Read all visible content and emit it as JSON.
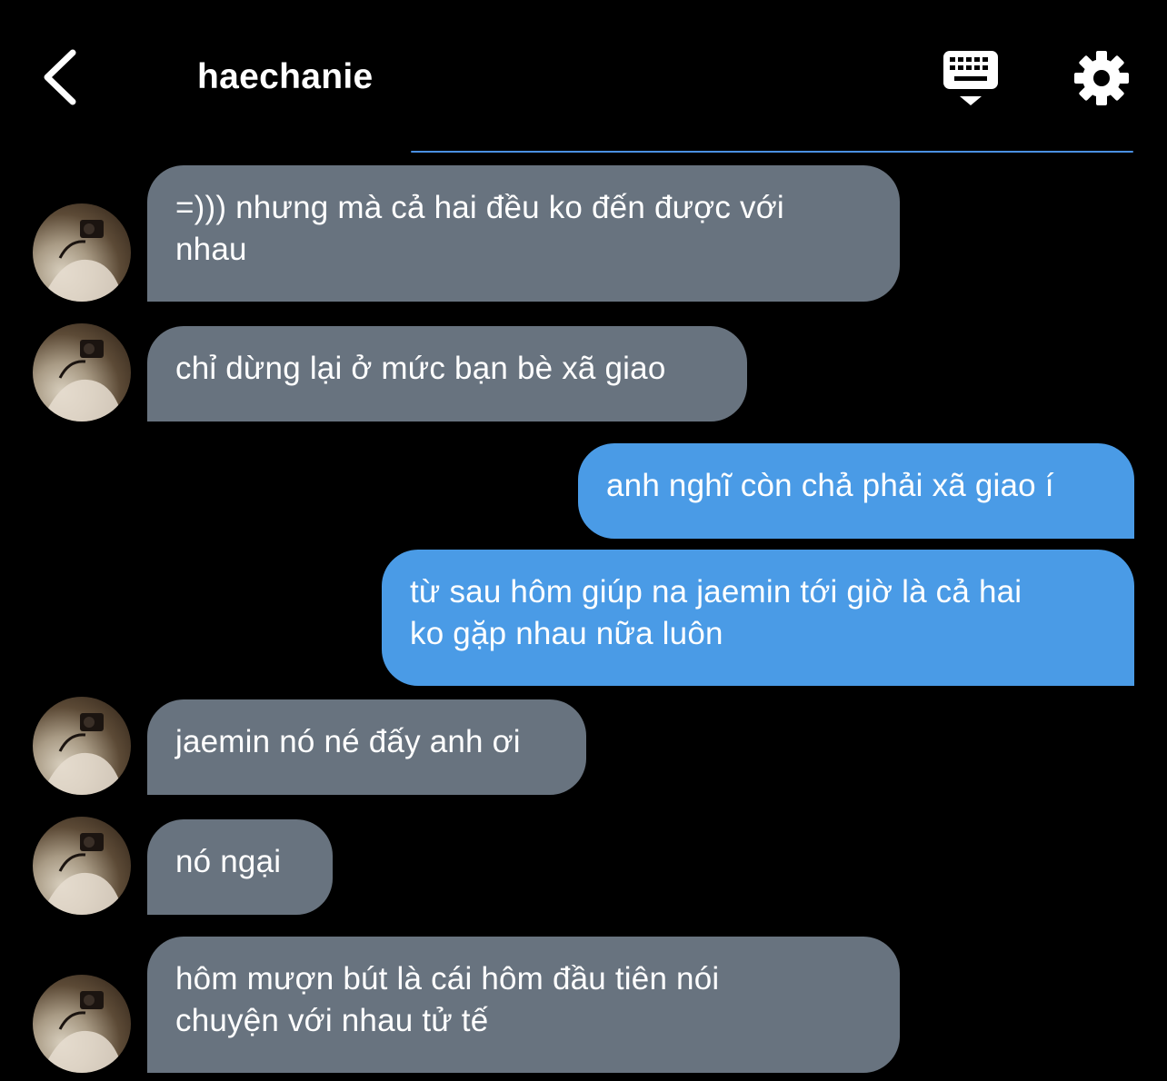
{
  "header": {
    "title": "haechanie",
    "back_icon": "chevron-left-icon",
    "keyboard_icon": "keyboard-icon",
    "settings_icon": "gear-icon"
  },
  "colors": {
    "background": "#000000",
    "incoming_bubble": "#68737f",
    "outgoing_bubble": "#4a9be6",
    "accent_line": "#4a90e2",
    "text": "#ffffff"
  },
  "messages": [
    {
      "direction": "in",
      "lines": [
        "=))) nhưng mà cả hai đều ko đến được với",
        "nhau"
      ]
    },
    {
      "direction": "in",
      "lines": [
        "chỉ dừng lại ở mức bạn bè xã giao"
      ]
    },
    {
      "direction": "out",
      "lines": [
        "anh nghĩ còn chả phải xã giao í"
      ]
    },
    {
      "direction": "out",
      "lines": [
        "từ sau hôm giúp na jaemin tới giờ là cả hai",
        "ko gặp nhau nữa luôn"
      ]
    },
    {
      "direction": "in",
      "lines": [
        "jaemin nó né đấy anh ơi"
      ]
    },
    {
      "direction": "in",
      "lines": [
        "nó ngại"
      ]
    },
    {
      "direction": "in",
      "lines": [
        "hôm mượn bút là cái hôm đầu tiên nói",
        "chuyện với nhau tử tế"
      ]
    }
  ]
}
